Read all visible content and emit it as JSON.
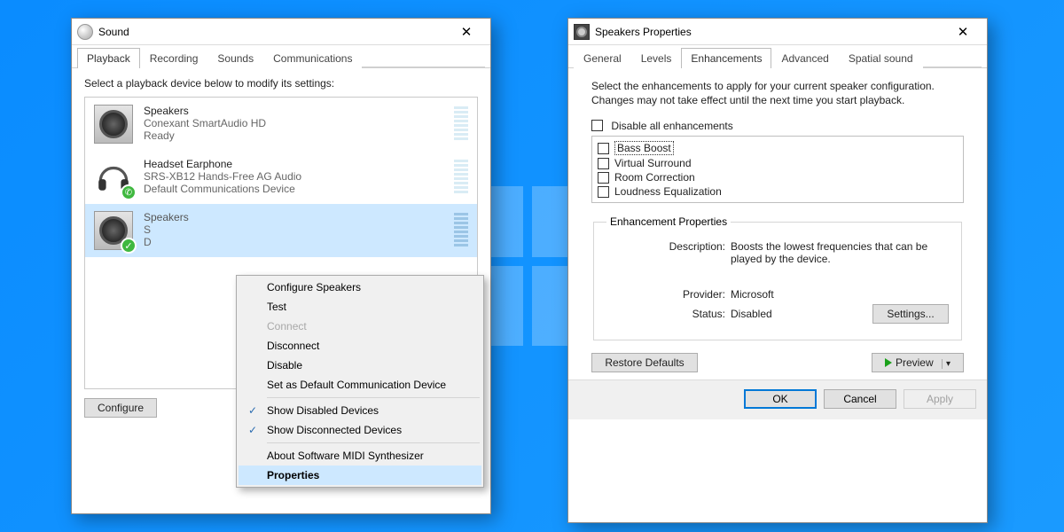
{
  "sound_window": {
    "title": "Sound",
    "tabs": [
      "Playback",
      "Recording",
      "Sounds",
      "Communications"
    ],
    "active_tab_index": 0,
    "instruction": "Select a playback device below to modify its settings:",
    "devices": [
      {
        "name": "Speakers",
        "desc": "Conexant SmartAudio HD",
        "status": "Ready",
        "badge": "none"
      },
      {
        "name": "Headset Earphone",
        "desc": "SRS-XB12 Hands-Free AG Audio",
        "status": "Default Communications Device",
        "badge": "phone"
      },
      {
        "name": "Speakers",
        "desc": "S",
        "status": "D",
        "badge": "check",
        "selected": true
      }
    ],
    "buttons": {
      "configure": "Configure"
    },
    "context_menu": {
      "items": [
        {
          "label": "Configure Speakers",
          "type": "item"
        },
        {
          "label": "Test",
          "type": "item"
        },
        {
          "label": "Connect",
          "type": "item",
          "disabled": true
        },
        {
          "label": "Disconnect",
          "type": "item"
        },
        {
          "label": "Disable",
          "type": "item"
        },
        {
          "label": "Set as Default Communication Device",
          "type": "item"
        },
        {
          "type": "divider"
        },
        {
          "label": "Show Disabled Devices",
          "type": "item",
          "checked": true
        },
        {
          "label": "Show Disconnected Devices",
          "type": "item",
          "checked": true
        },
        {
          "type": "divider"
        },
        {
          "label": "About Software MIDI Synthesizer",
          "type": "item"
        },
        {
          "label": "Properties",
          "type": "item",
          "hovered": true
        }
      ]
    }
  },
  "props_window": {
    "title": "Speakers Properties",
    "tabs": [
      "General",
      "Levels",
      "Enhancements",
      "Advanced",
      "Spatial sound"
    ],
    "active_tab_index": 2,
    "intro": "Select the enhancements to apply for your current speaker configuration. Changes may not take effect until the next time you start playback.",
    "disable_all": "Disable all enhancements",
    "enhancements": [
      "Bass Boost",
      "Virtual Surround",
      "Room Correction",
      "Loudness Equalization"
    ],
    "focused_index": 0,
    "group_title": "Enhancement Properties",
    "description_label": "Description:",
    "description_value": "Boosts the lowest frequencies that can be played by the device.",
    "provider_label": "Provider:",
    "provider_value": "Microsoft",
    "status_label": "Status:",
    "status_value": "Disabled",
    "settings_btn": "Settings...",
    "restore_btn": "Restore Defaults",
    "preview_btn": "Preview",
    "ok": "OK",
    "cancel": "Cancel",
    "apply": "Apply"
  }
}
